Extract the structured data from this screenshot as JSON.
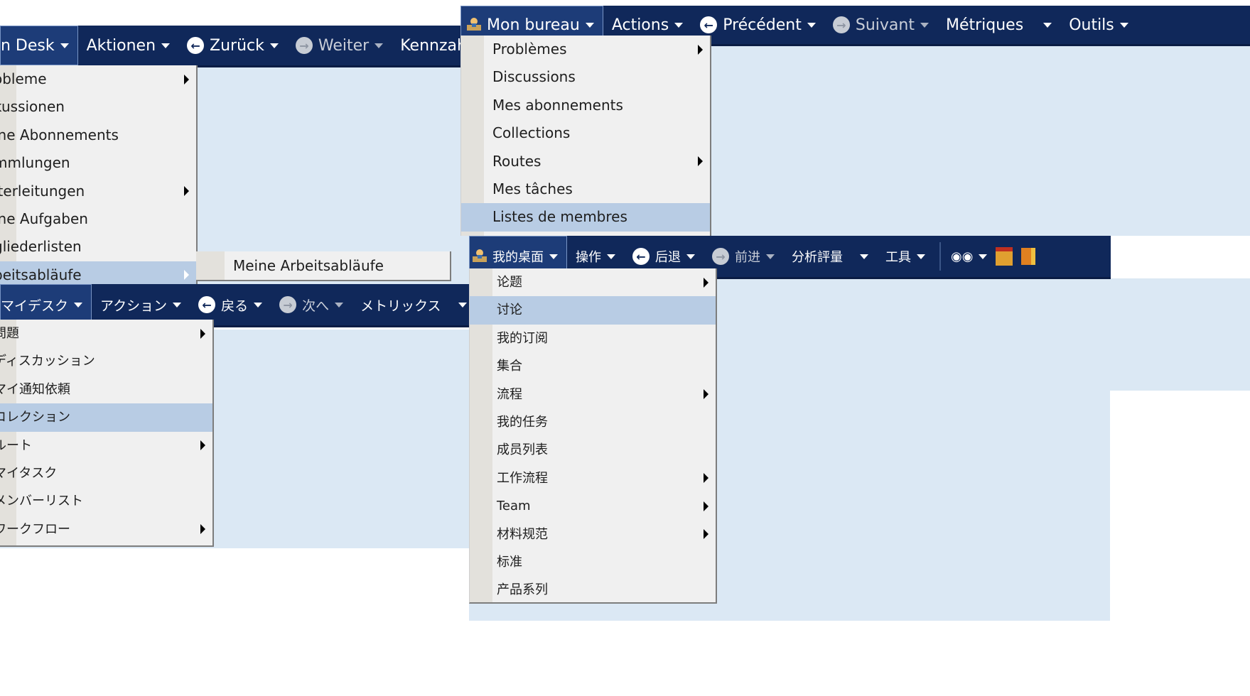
{
  "de": {
    "toolbar": {
      "desk": "n Desk",
      "actions": "Aktionen",
      "back": "Zurück",
      "forward": "Weiter",
      "metrics": "Kennzah"
    },
    "menu": [
      {
        "label": "obleme",
        "submenu": true
      },
      {
        "label": "kussionen",
        "submenu": false
      },
      {
        "label": "ine Abonnements",
        "submenu": false
      },
      {
        "label": "mmlungen",
        "submenu": false
      },
      {
        "label": "iterleitungen",
        "submenu": true
      },
      {
        "label": "ine Aufgaben",
        "submenu": false
      },
      {
        "label": "gliederlisten",
        "submenu": false
      },
      {
        "label": "beitsabläufe",
        "submenu": true,
        "highlighted": true
      }
    ],
    "submenu": [
      "Meine Arbeitsabläufe"
    ]
  },
  "ja": {
    "toolbar": {
      "desk": "マイデスク",
      "actions": "アクション",
      "back": "戻る",
      "forward": "次へ",
      "metrics": "メトリックス"
    },
    "menu": [
      {
        "label": "問題",
        "submenu": true
      },
      {
        "label": "ディスカッション",
        "submenu": false
      },
      {
        "label": "マイ通知依頼",
        "submenu": false
      },
      {
        "label": "コレクション",
        "submenu": false,
        "highlighted": true
      },
      {
        "label": "ルート",
        "submenu": true
      },
      {
        "label": "マイタスク",
        "submenu": false
      },
      {
        "label": "メンバーリスト",
        "submenu": false
      },
      {
        "label": "ワークフロー",
        "submenu": true
      }
    ]
  },
  "fr": {
    "toolbar": {
      "desk": "Mon bureau",
      "actions": "Actions",
      "back": "Précédent",
      "forward": "Suivant",
      "metrics": "Métriques",
      "tools": "Outils"
    },
    "menu": [
      {
        "label": "Problèmes",
        "submenu": true
      },
      {
        "label": "Discussions",
        "submenu": false
      },
      {
        "label": "Mes abonnements",
        "submenu": false
      },
      {
        "label": "Collections",
        "submenu": false
      },
      {
        "label": "Routes",
        "submenu": true
      },
      {
        "label": "Mes tâches",
        "submenu": false
      },
      {
        "label": "Listes de membres",
        "submenu": false,
        "highlighted": true
      }
    ]
  },
  "zh": {
    "toolbar": {
      "desk": "我的桌面",
      "actions": "操作",
      "back": "后退",
      "forward": "前进",
      "metrics": "分析評量",
      "tools": "工具"
    },
    "menu": [
      {
        "label": "论题",
        "submenu": true
      },
      {
        "label": "讨论",
        "submenu": false,
        "highlighted": true
      },
      {
        "label": "我的订阅",
        "submenu": false
      },
      {
        "label": "集合",
        "submenu": false
      },
      {
        "label": "流程",
        "submenu": true
      },
      {
        "label": "我的任务",
        "submenu": false
      },
      {
        "label": "成员列表",
        "submenu": false
      },
      {
        "label": "工作流程",
        "submenu": true
      },
      {
        "label": "Team",
        "submenu": true
      },
      {
        "label": "材料规范",
        "submenu": true
      },
      {
        "label": "标准",
        "submenu": false
      },
      {
        "label": "产品系列",
        "submenu": false
      }
    ]
  },
  "icons": {
    "desk": "desk-user-icon",
    "back": "back-arrow-icon",
    "forward": "forward-arrow-icon",
    "search": "binoculars-icon",
    "home": "home-icon",
    "logout": "logout-door-icon"
  },
  "colors": {
    "toolbar_bg": "#10285a",
    "content_bg": "#dbe8f4",
    "menu_bg": "#f0f0f0",
    "menu_highlight": "#b8cce4",
    "gutter": "#e3e1dc"
  }
}
